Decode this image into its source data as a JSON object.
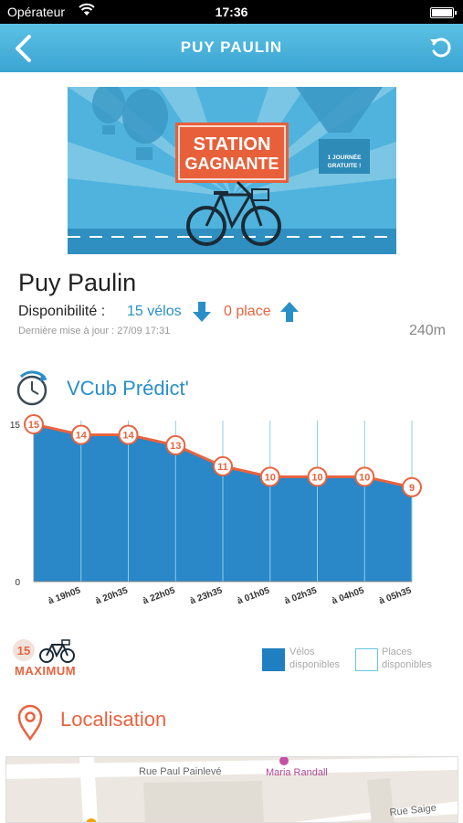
{
  "status_bar": {
    "carrier": "Opérateur",
    "time": "17:36"
  },
  "nav": {
    "title": "PUY PAULIN"
  },
  "banner": {
    "line1": "STATION",
    "line2": "GAGNANTE",
    "sign1": "1 JOURNÉE",
    "sign2": "GRATUITE !"
  },
  "station": {
    "name": "Puy Paulin",
    "availability_label": "Disponibilité :",
    "bikes": "15 vélos",
    "places": "0 place",
    "last_update": "Dernière mise à jour : 27/09 17:31",
    "distance": "240m"
  },
  "predict": {
    "title": "VCub Prédict'"
  },
  "chart_data": {
    "type": "area",
    "x": [
      "",
      "à 19h05",
      "à 20h35",
      "à 22h05",
      "à 23h35",
      "à 01h05",
      "à 02h35",
      "à 04h05",
      "à 05h35"
    ],
    "series": [
      {
        "name": "Vélos disponibles",
        "values": [
          15,
          14,
          14,
          13,
          11,
          10,
          10,
          10,
          9
        ]
      }
    ],
    "ylim": [
      0,
      15
    ],
    "y_ticks": [
      "0",
      "15"
    ],
    "colors": {
      "area": "#2a87c8",
      "line": "#e8633f",
      "grid": "#8ccfe8"
    }
  },
  "capacity": {
    "value": "15",
    "label": "MAXIMUM"
  },
  "legend": {
    "bikes_label": "Vélos disponibles",
    "places_label": "Places disponibles"
  },
  "location": {
    "title": "Localisation"
  },
  "map": {
    "street1": "Rue Paul Painlevé",
    "poi": "Maria Randall",
    "street2": "Rue Saige"
  },
  "colors": {
    "accent_blue": "#2a8fc7",
    "accent_orange": "#e8633f",
    "nav": "#45b0da"
  }
}
